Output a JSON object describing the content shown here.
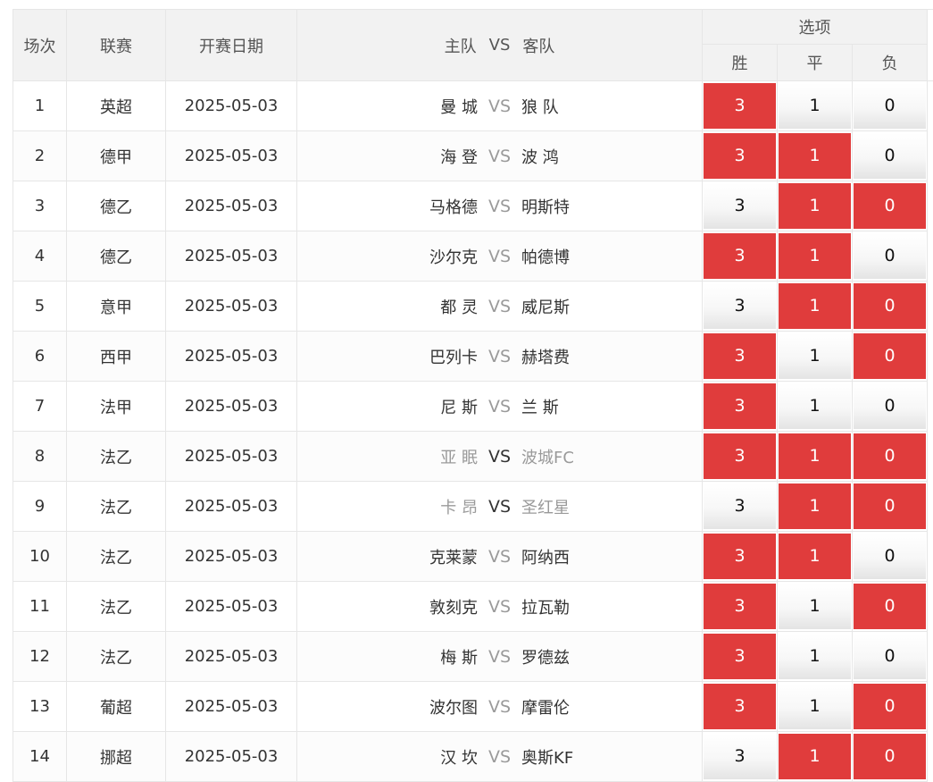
{
  "header": {
    "idx": "场次",
    "league": "联赛",
    "date": "开赛日期",
    "home": "主队",
    "vs": "VS",
    "away": "客队",
    "options": "选项",
    "win": "胜",
    "draw": "平",
    "lose": "负"
  },
  "colors": {
    "selected": "#e03c3c",
    "header_bg": "#f2f2f2",
    "muted_text": "#9a9a9a"
  },
  "rows": [
    {
      "idx": "1",
      "league": "英超",
      "date": "2025-05-03",
      "home": "曼 城",
      "vs": "VS",
      "away": "狼 队",
      "win": "3",
      "draw": "1",
      "lose": "0",
      "sel": [
        true,
        false,
        false
      ],
      "muted": false
    },
    {
      "idx": "2",
      "league": "德甲",
      "date": "2025-05-03",
      "home": "海 登",
      "vs": "VS",
      "away": "波 鸿",
      "win": "3",
      "draw": "1",
      "lose": "0",
      "sel": [
        true,
        true,
        false
      ],
      "muted": false
    },
    {
      "idx": "3",
      "league": "德乙",
      "date": "2025-05-03",
      "home": "马格德",
      "vs": "VS",
      "away": "明斯特",
      "win": "3",
      "draw": "1",
      "lose": "0",
      "sel": [
        false,
        true,
        true
      ],
      "muted": false
    },
    {
      "idx": "4",
      "league": "德乙",
      "date": "2025-05-03",
      "home": "沙尔克",
      "vs": "VS",
      "away": "帕德博",
      "win": "3",
      "draw": "1",
      "lose": "0",
      "sel": [
        true,
        true,
        false
      ],
      "muted": false
    },
    {
      "idx": "5",
      "league": "意甲",
      "date": "2025-05-03",
      "home": "都 灵",
      "vs": "VS",
      "away": "威尼斯",
      "win": "3",
      "draw": "1",
      "lose": "0",
      "sel": [
        false,
        true,
        true
      ],
      "muted": false
    },
    {
      "idx": "6",
      "league": "西甲",
      "date": "2025-05-03",
      "home": "巴列卡",
      "vs": "VS",
      "away": "赫塔费",
      "win": "3",
      "draw": "1",
      "lose": "0",
      "sel": [
        true,
        false,
        true
      ],
      "muted": false
    },
    {
      "idx": "7",
      "league": "法甲",
      "date": "2025-05-03",
      "home": "尼 斯",
      "vs": "VS",
      "away": "兰 斯",
      "win": "3",
      "draw": "1",
      "lose": "0",
      "sel": [
        true,
        false,
        false
      ],
      "muted": false
    },
    {
      "idx": "8",
      "league": "法乙",
      "date": "2025-05-03",
      "home": "亚 眠",
      "vs": "VS",
      "away": "波城FC",
      "win": "3",
      "draw": "1",
      "lose": "0",
      "sel": [
        true,
        true,
        true
      ],
      "muted": true
    },
    {
      "idx": "9",
      "league": "法乙",
      "date": "2025-05-03",
      "home": "卡 昂",
      "vs": "VS",
      "away": "圣红星",
      "win": "3",
      "draw": "1",
      "lose": "0",
      "sel": [
        false,
        true,
        true
      ],
      "muted": true
    },
    {
      "idx": "10",
      "league": "法乙",
      "date": "2025-05-03",
      "home": "克莱蒙",
      "vs": "VS",
      "away": "阿纳西",
      "win": "3",
      "draw": "1",
      "lose": "0",
      "sel": [
        true,
        true,
        false
      ],
      "muted": false
    },
    {
      "idx": "11",
      "league": "法乙",
      "date": "2025-05-03",
      "home": "敦刻克",
      "vs": "VS",
      "away": "拉瓦勒",
      "win": "3",
      "draw": "1",
      "lose": "0",
      "sel": [
        true,
        false,
        true
      ],
      "muted": false
    },
    {
      "idx": "12",
      "league": "法乙",
      "date": "2025-05-03",
      "home": "梅 斯",
      "vs": "VS",
      "away": "罗德兹",
      "win": "3",
      "draw": "1",
      "lose": "0",
      "sel": [
        true,
        false,
        false
      ],
      "muted": false
    },
    {
      "idx": "13",
      "league": "葡超",
      "date": "2025-05-03",
      "home": "波尔图",
      "vs": "VS",
      "away": "摩雷伦",
      "win": "3",
      "draw": "1",
      "lose": "0",
      "sel": [
        true,
        false,
        true
      ],
      "muted": false
    },
    {
      "idx": "14",
      "league": "挪超",
      "date": "2025-05-03",
      "home": "汉 坎",
      "vs": "VS",
      "away": "奥斯KF",
      "win": "3",
      "draw": "1",
      "lose": "0",
      "sel": [
        false,
        true,
        true
      ],
      "muted": false
    }
  ]
}
